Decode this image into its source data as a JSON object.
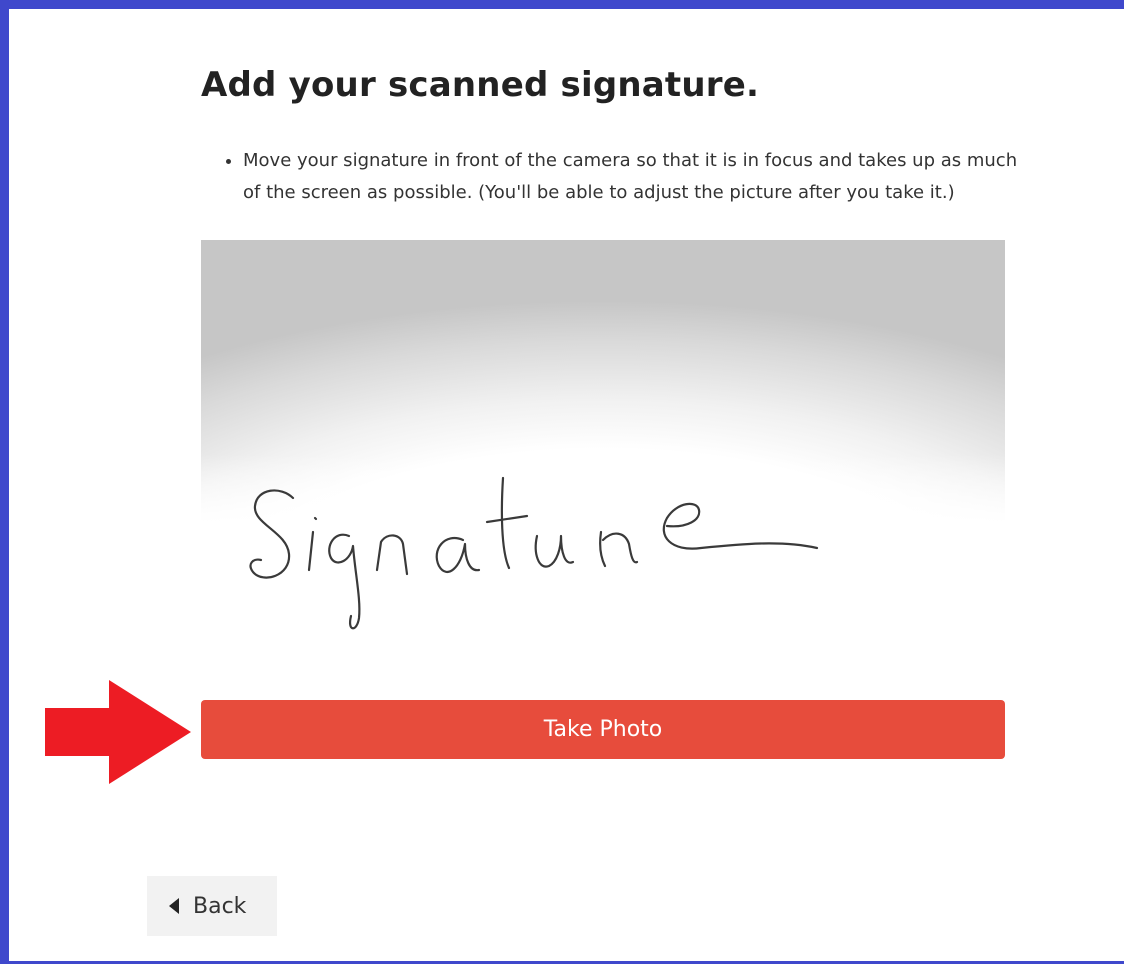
{
  "page": {
    "title": "Add your scanned signature.",
    "instructions": [
      "Move your signature in front of the camera so that it is in focus and takes up as much of the screen as possible. (You'll be able to adjust the picture after you take it.)"
    ]
  },
  "camera": {
    "signature_text": "Signature"
  },
  "actions": {
    "take_photo_label": "Take Photo",
    "back_label": "Back"
  },
  "colors": {
    "frame_border": "#3f48cc",
    "take_photo_bg": "#e74c3c",
    "arrow": "#ed1c24",
    "back_bg": "#f2f2f2"
  },
  "icons": {
    "arrow": "arrow-right-icon",
    "back": "triangle-left-icon"
  }
}
